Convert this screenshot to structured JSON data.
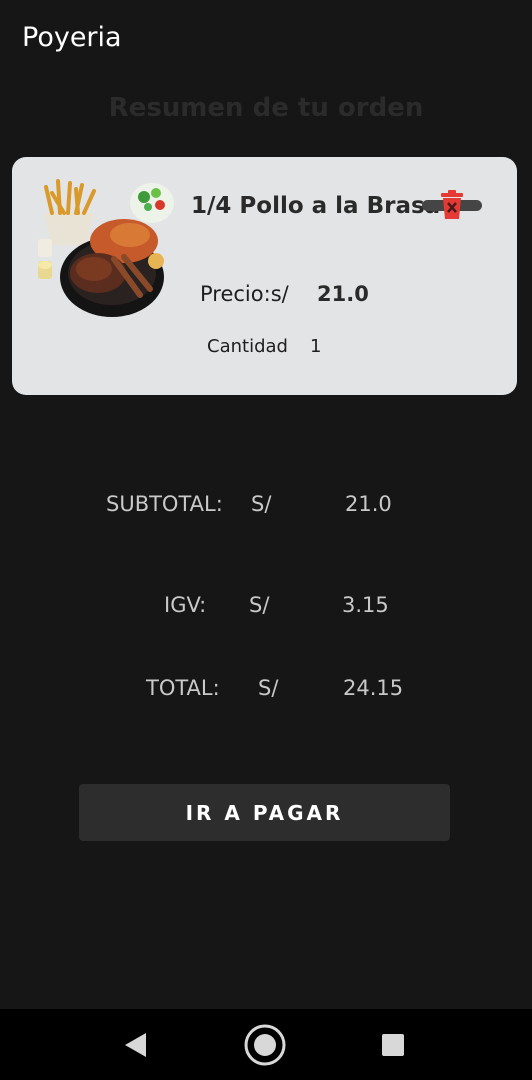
{
  "app": {
    "title": "Poyeria"
  },
  "screen": {
    "title": "Resumen de tu orden"
  },
  "order_item": {
    "name": "1/4 Pollo a la Brasa",
    "price_label": "Precio:s/",
    "price_value": "21.0",
    "quantity_label": "Cantidad",
    "quantity_value": "1",
    "image_icon": "roast-chicken-platter",
    "delete_icon": "trash-icon"
  },
  "summary": {
    "subtotal_label": "SUBTOTAL:",
    "subtotal_currency": "S/",
    "subtotal_value": "21.0",
    "igv_label": "IGV:",
    "igv_currency": "S/",
    "igv_value": "3.15",
    "total_label": "TOTAL:",
    "total_currency": "S/",
    "total_value": "24.15"
  },
  "actions": {
    "pay_label": "IR A PAGAR"
  },
  "colors": {
    "background": "#161616",
    "card": "#e3e4e6",
    "button": "#2d2d2d",
    "delete": "#e53935"
  },
  "navigation": {
    "back_icon": "back-triangle-icon",
    "home_icon": "home-circle-icon",
    "recents_icon": "recents-square-icon"
  }
}
